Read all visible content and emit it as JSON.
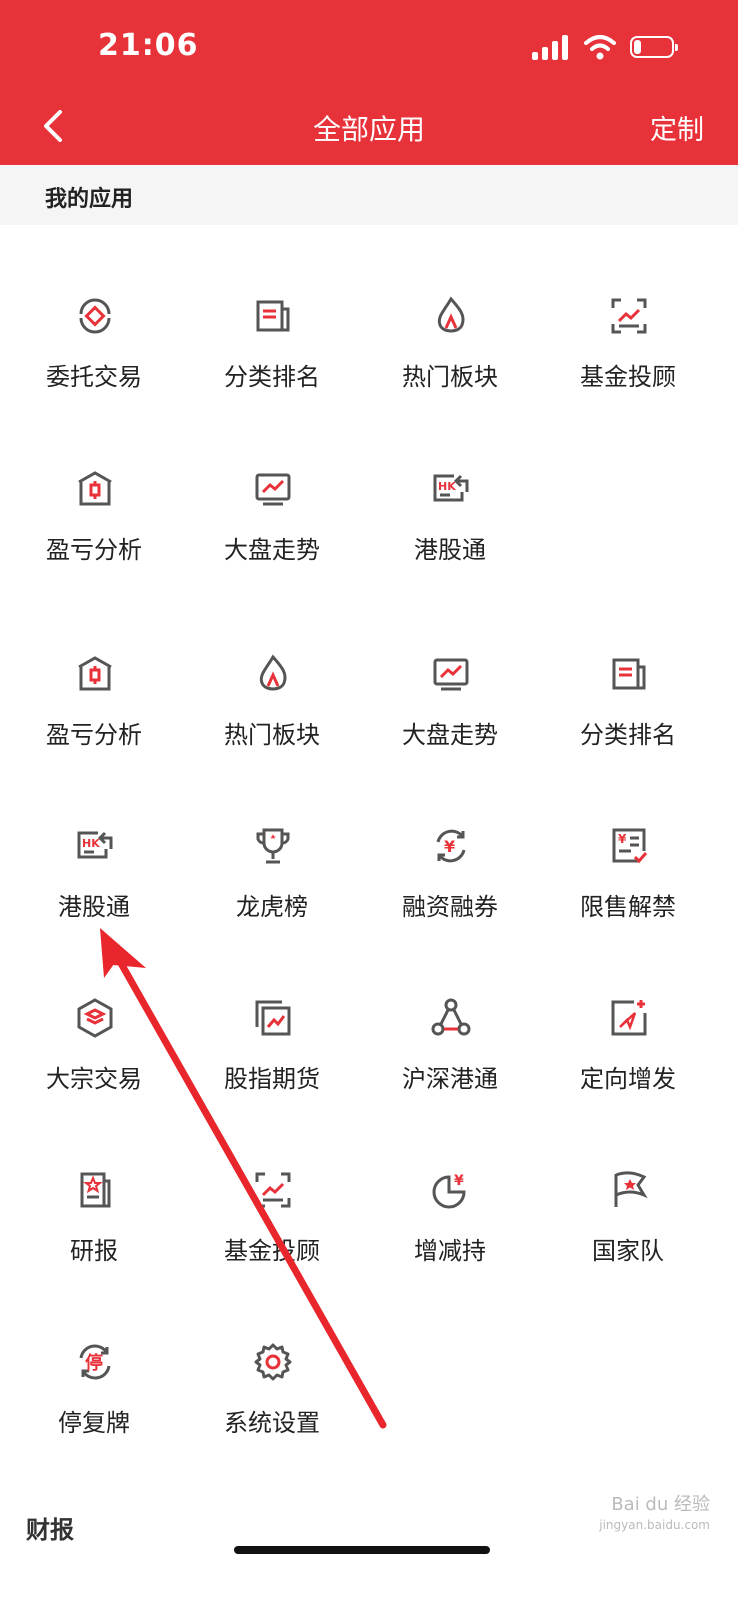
{
  "status": {
    "time": "21:06"
  },
  "header": {
    "title": "全部应用",
    "custom": "定制"
  },
  "section": {
    "title": "我的应用"
  },
  "footer": {
    "title": "财报"
  },
  "watermark": {
    "brand": "Bai du 经验",
    "url": "jingyan.baidu.com"
  },
  "colors": {
    "accent": "#e8323a",
    "icon_gray": "#555555"
  },
  "apps": [
    {
      "label": "委托交易",
      "icon": "delegate-trade-icon"
    },
    {
      "label": "分类排名",
      "icon": "category-rank-icon"
    },
    {
      "label": "热门板块",
      "icon": "hot-sector-icon"
    },
    {
      "label": "基金投顾",
      "icon": "fund-advisor-icon"
    },
    {
      "label": "盈亏分析",
      "icon": "profit-loss-icon"
    },
    {
      "label": "大盘走势",
      "icon": "market-trend-icon"
    },
    {
      "label": "港股通",
      "icon": "hk-connect-icon"
    },
    {
      "label": "盈亏分析",
      "icon": "profit-loss-icon"
    },
    {
      "label": "热门板块",
      "icon": "hot-sector-icon"
    },
    {
      "label": "大盘走势",
      "icon": "market-trend-icon"
    },
    {
      "label": "分类排名",
      "icon": "category-rank-icon"
    },
    {
      "label": "港股通",
      "icon": "hk-connect-icon"
    },
    {
      "label": "龙虎榜",
      "icon": "trophy-icon"
    },
    {
      "label": "融资融券",
      "icon": "margin-trading-icon"
    },
    {
      "label": "限售解禁",
      "icon": "lockup-release-icon"
    },
    {
      "label": "大宗交易",
      "icon": "block-trade-icon"
    },
    {
      "label": "股指期货",
      "icon": "index-futures-icon"
    },
    {
      "label": "沪深港通",
      "icon": "connect-network-icon"
    },
    {
      "label": "定向增发",
      "icon": "private-placement-icon"
    },
    {
      "label": "研报",
      "icon": "research-report-icon"
    },
    {
      "label": "基金投顾",
      "icon": "fund-advisor-icon"
    },
    {
      "label": "增减持",
      "icon": "holding-change-icon"
    },
    {
      "label": "国家队",
      "icon": "national-team-flag-icon"
    },
    {
      "label": "停复牌",
      "icon": "suspension-icon"
    },
    {
      "label": "系统设置",
      "icon": "settings-gear-icon"
    }
  ]
}
